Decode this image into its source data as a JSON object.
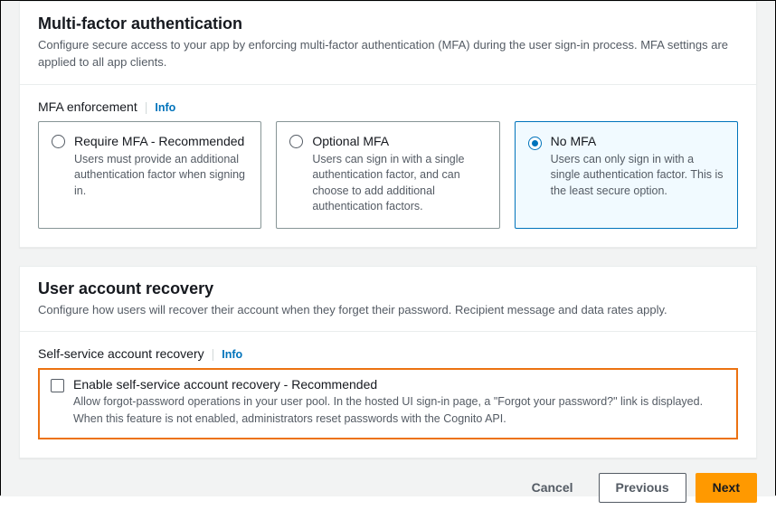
{
  "mfa": {
    "title": "Multi-factor authentication",
    "description": "Configure secure access to your app by enforcing multi-factor authentication (MFA) during the user sign-in process. MFA settings are applied to all app clients.",
    "field_label": "MFA enforcement",
    "info": "Info",
    "options": [
      {
        "title": "Require MFA - Recommended",
        "description": "Users must provide an additional authentication factor when signing in.",
        "selected": false
      },
      {
        "title": "Optional MFA",
        "description": "Users can sign in with a single authentication factor, and can choose to add additional authentication factors.",
        "selected": false
      },
      {
        "title": "No MFA",
        "description": "Users can only sign in with a single authentication factor. This is the least secure option.",
        "selected": true
      }
    ]
  },
  "recovery": {
    "title": "User account recovery",
    "description": "Configure how users will recover their account when they forget their password. Recipient message and data rates apply.",
    "field_label": "Self-service account recovery",
    "info": "Info",
    "checkbox": {
      "title": "Enable self-service account recovery - Recommended",
      "description": "Allow forgot-password operations in your user pool. In the hosted UI sign-in page, a \"Forgot your password?\" link is displayed. When this feature is not enabled, administrators reset passwords with the Cognito API.",
      "checked": false
    }
  },
  "footer": {
    "cancel": "Cancel",
    "previous": "Previous",
    "next": "Next"
  }
}
